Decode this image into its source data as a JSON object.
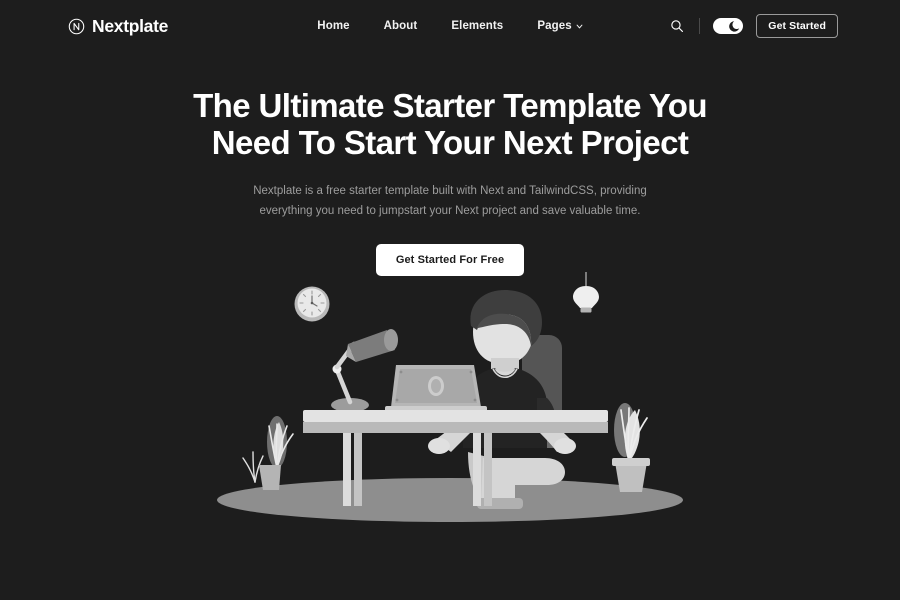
{
  "brand": {
    "name": "Nextplate",
    "logo_icon": "circled-n-icon"
  },
  "nav": {
    "items": [
      {
        "label": "Home",
        "has_dropdown": false
      },
      {
        "label": "About",
        "has_dropdown": false
      },
      {
        "label": "Elements",
        "has_dropdown": false
      },
      {
        "label": "Pages",
        "has_dropdown": true
      }
    ]
  },
  "actions": {
    "search_icon": "search-icon",
    "theme_toggle": {
      "icon": "moon-icon",
      "state": "dark"
    },
    "get_started_label": "Get Started"
  },
  "hero": {
    "title_line1": "The Ultimate Starter Template You",
    "title_line2": "Need To Start Your Next Project",
    "description": "Nextplate is a free starter template built with Next and TailwindCSS, providing everything you need to jumpstart your Next project and save valuable time.",
    "cta_label": "Get Started For Free"
  },
  "illustration": {
    "name": "developer-at-desk-illustration",
    "elements": [
      "wall-clock",
      "hanging-light-bulb",
      "desk-lamp",
      "laptop",
      "person",
      "office-chair",
      "desk",
      "potted-plant-left",
      "potted-plant-right",
      "floor-shadow"
    ]
  },
  "colors": {
    "background": "#1d1d1d",
    "text_primary": "#ffffff",
    "text_muted": "#9d9d9d",
    "accent": "#ffffff"
  }
}
